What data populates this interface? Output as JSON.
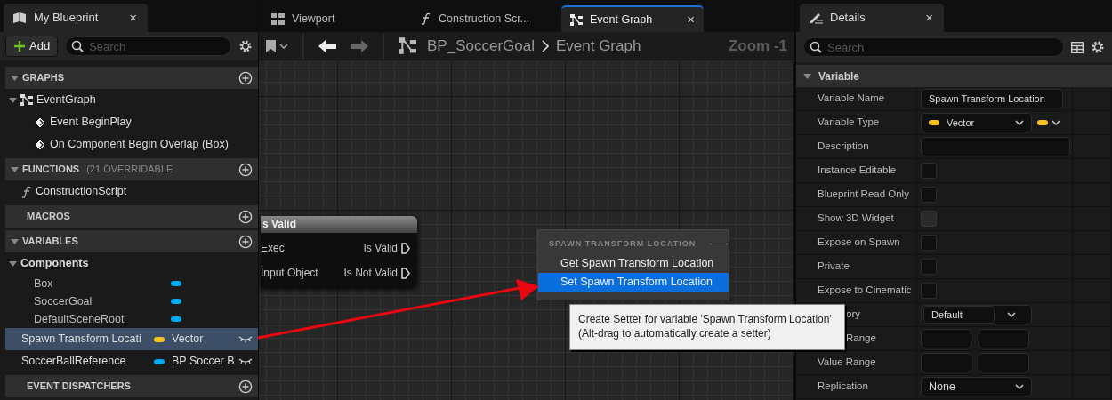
{
  "my_blueprint": {
    "tab": {
      "title": "My Blueprint",
      "close": "×"
    },
    "add_button": "Add",
    "search": {
      "placeholder": "Search"
    },
    "sections": [
      {
        "title": "GRAPHS",
        "expanded": true,
        "items": [
          {
            "kind": "graph",
            "label": "EventGraph",
            "expanded": true,
            "children": [
              {
                "kind": "event",
                "label": "Event BeginPlay"
              },
              {
                "kind": "event",
                "label": "On Component Begin Overlap (Box)"
              }
            ]
          }
        ]
      },
      {
        "title": "FUNCTIONS",
        "note": "(21 OVERRIDABLE",
        "expanded": true,
        "items": [
          {
            "kind": "function",
            "label": "ConstructionScript"
          }
        ]
      },
      {
        "title": "MACROS"
      },
      {
        "title": "VARIABLES",
        "expanded": true,
        "items": [
          {
            "kind": "category",
            "label": "Components",
            "expanded": true,
            "children": [
              {
                "kind": "component",
                "label": "Box",
                "color": "#00a8f0"
              },
              {
                "kind": "component",
                "label": "SoccerGoal",
                "color": "#00a8f0"
              },
              {
                "kind": "component",
                "label": "DefaultSceneRoot",
                "color": "#00a8f0"
              }
            ]
          },
          {
            "kind": "variable",
            "label": "Spawn Transform Locati",
            "type": "Vector",
            "color": "#f7c21b",
            "selected": true
          },
          {
            "kind": "variable",
            "label": "SoccerBallReference",
            "type": "BP Soccer B",
            "color": "#00a8f0",
            "selected": false
          }
        ]
      },
      {
        "title": "EVENT DISPATCHERS"
      }
    ]
  },
  "graph_editor": {
    "tabs": [
      {
        "kind": "viewport",
        "label": "Viewport",
        "selected": false
      },
      {
        "kind": "function",
        "label": "Construction Scr...",
        "selected": false
      },
      {
        "kind": "graph",
        "label": "Event Graph",
        "selected": true,
        "close": "×"
      }
    ],
    "back": {
      "disabled": false
    },
    "forward": {
      "disabled": true
    },
    "breadcrumb": [
      "BP_SoccerGoal",
      "Event Graph"
    ],
    "zoom": "Zoom -1",
    "node": {
      "title": "s Valid",
      "inputs": [
        "Exec",
        "Input Object"
      ],
      "outputs": [
        "Is Valid",
        "Is Not Valid"
      ]
    },
    "context_menu": {
      "heading": "SPAWN TRANSFORM LOCATION",
      "items": [
        {
          "label": "Get Spawn Transform Location",
          "selected": false
        },
        {
          "label": "Set Spawn Transform Location",
          "selected": true
        }
      ]
    },
    "tooltip": "Create Setter for variable 'Spawn Transform Location'\n(Alt-drag to automatically create a setter)"
  },
  "details": {
    "tab": {
      "title": "Details",
      "close": "×"
    },
    "search": {
      "placeholder": "Search"
    },
    "section": {
      "title": "Variable",
      "expanded": true
    },
    "properties": [
      {
        "label": "Variable Name",
        "kind": "text",
        "value": "Spawn Transform Location"
      },
      {
        "label": "Variable Type",
        "kind": "type",
        "value": "Vector",
        "color": "#f7c21b"
      },
      {
        "label": "Description",
        "kind": "text"
      },
      {
        "label": "Instance Editable",
        "kind": "checkbox",
        "checked": false,
        "disabled": false
      },
      {
        "label": "Blueprint Read Only",
        "kind": "checkbox",
        "checked": false,
        "disabled": false
      },
      {
        "label": "Show 3D Widget",
        "kind": "checkbox",
        "checked": false,
        "disabled": true
      },
      {
        "label": "Expose on Spawn",
        "kind": "checkbox",
        "checked": false,
        "disabled": false
      },
      {
        "label": "Private",
        "kind": "checkbox",
        "checked": false,
        "disabled": false
      },
      {
        "label": "Expose to Cinematic",
        "kind": "checkbox",
        "checked": false,
        "disabled": false
      },
      {
        "label": "ory",
        "partly_hidden": true,
        "kind": "combo",
        "value": "Default"
      },
      {
        "label": "Range",
        "partly_hidden": true,
        "kind": "range"
      },
      {
        "label": "Value Range",
        "kind": "range"
      },
      {
        "label": "Replication",
        "kind": "select",
        "value": "None"
      }
    ]
  }
}
